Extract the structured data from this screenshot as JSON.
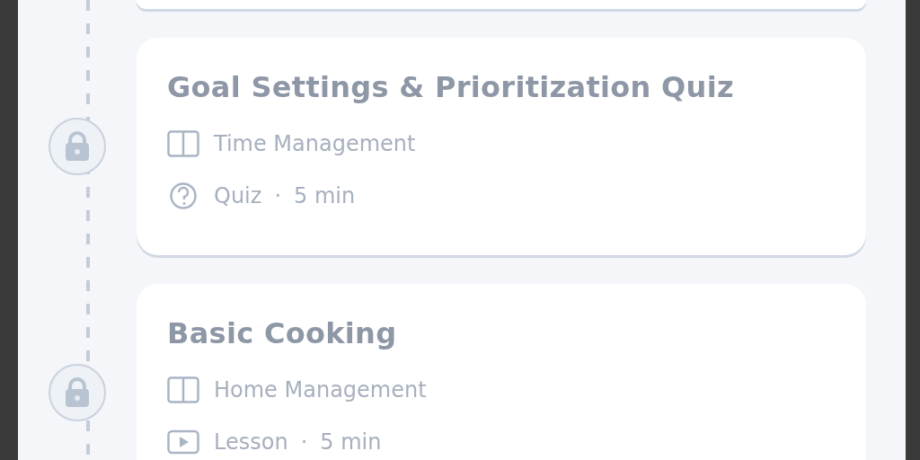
{
  "items": [
    {
      "title": "Goal Settings & Prioritization Quiz",
      "category": "Time Management",
      "kind": "quiz",
      "type": "Quiz",
      "separator": "·",
      "duration": "5 min",
      "locked": true
    },
    {
      "title": "Basic Cooking",
      "category": "Home Management",
      "kind": "lesson",
      "type": "Lesson",
      "separator": "·",
      "duration": "5 min",
      "locked": true
    }
  ]
}
